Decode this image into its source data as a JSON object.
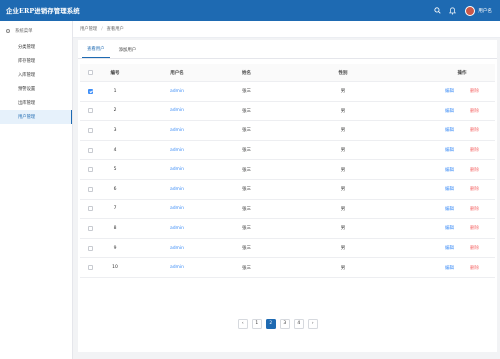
{
  "app": {
    "title": "企业ERP进销存管理系统"
  },
  "header": {
    "username": "用户名"
  },
  "sidebar": {
    "title": "系统菜单",
    "items": [
      {
        "label": "分类管理"
      },
      {
        "label": "库存管理"
      },
      {
        "label": "入库管理"
      },
      {
        "label": "预警设置"
      },
      {
        "label": "出库管理"
      },
      {
        "label": "用户管理"
      }
    ]
  },
  "breadcrumb": {
    "parent": "用户管理",
    "separator": "/",
    "current": "查看用户"
  },
  "tabs": [
    {
      "label": "查看用户"
    },
    {
      "label": "添加用户"
    }
  ],
  "table": {
    "headers": {
      "id": "编号",
      "username": "用户名",
      "name": "姓名",
      "gender": "性别",
      "actions": "操作"
    },
    "edit_label": "编辑",
    "delete_label": "删除",
    "rows": [
      {
        "id": "1",
        "username": "admin",
        "name": "张三",
        "gender": "男",
        "checked": true
      },
      {
        "id": "2",
        "username": "admin",
        "name": "张三",
        "gender": "男",
        "checked": false
      },
      {
        "id": "3",
        "username": "admin",
        "name": "张三",
        "gender": "男",
        "checked": false
      },
      {
        "id": "4",
        "username": "admin",
        "name": "张三",
        "gender": "男",
        "checked": false
      },
      {
        "id": "5",
        "username": "admin",
        "name": "张三",
        "gender": "男",
        "checked": false
      },
      {
        "id": "6",
        "username": "admin",
        "name": "张三",
        "gender": "男",
        "checked": false
      },
      {
        "id": "7",
        "username": "admin",
        "name": "张三",
        "gender": "男",
        "checked": false
      },
      {
        "id": "8",
        "username": "admin",
        "name": "张三",
        "gender": "男",
        "checked": false
      },
      {
        "id": "9",
        "username": "admin",
        "name": "张三",
        "gender": "男",
        "checked": false
      },
      {
        "id": "10",
        "username": "admin",
        "name": "张三",
        "gender": "男",
        "checked": false
      }
    ]
  },
  "pagination": {
    "prev": "‹",
    "next": "›",
    "pages": [
      "1",
      "2",
      "3",
      "4"
    ],
    "current": "2"
  },
  "colors": {
    "header": "#1e6ab2",
    "link": "#3e8ef7",
    "danger": "#f56c6c",
    "active_bg": "#e6f1fb"
  },
  "icons": {
    "search": "search-icon",
    "bell": "bell-icon",
    "menu": "menu-circle-icon"
  }
}
